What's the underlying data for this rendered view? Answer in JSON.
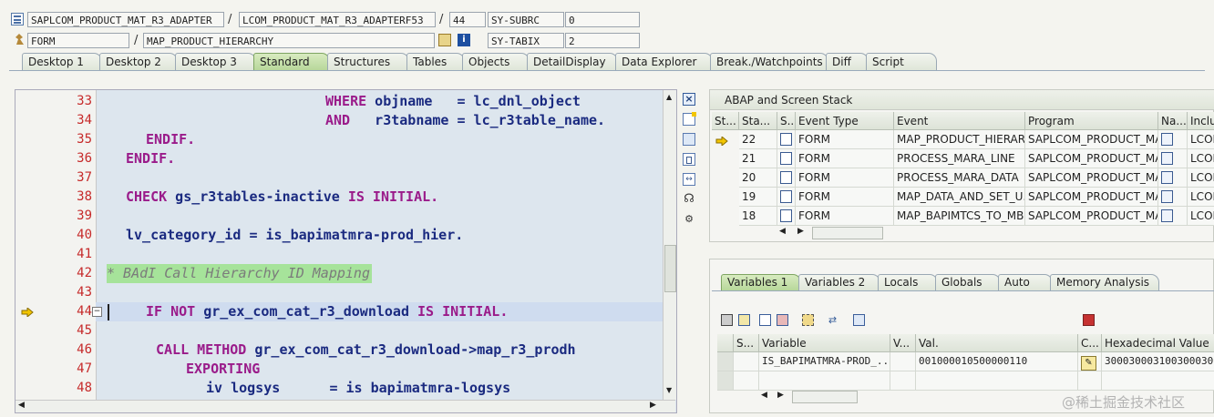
{
  "header": {
    "row1": {
      "program": "SAPLCOM_PRODUCT_MAT_R3_ADAPTER",
      "include": "LCOM_PRODUCT_MAT_R3_ADAPTERF53",
      "line": "44",
      "sysfield": "SY-SUBRC",
      "sysvalue": "0"
    },
    "row2": {
      "type": "FORM",
      "name": "MAP_PRODUCT_HIERARCHY",
      "sysfield": "SY-TABIX",
      "sysvalue": "2"
    },
    "sep": "/"
  },
  "tabs": [
    "Desktop 1",
    "Desktop 2",
    "Desktop 3",
    "Standard",
    "Structures",
    "Tables",
    "Objects",
    "DetailDisplay",
    "Data Explorer",
    "Break./Watchpoints",
    "Diff",
    "Script"
  ],
  "active_tab": "Standard",
  "code": {
    "lines": [
      "33",
      "34",
      "35",
      "36",
      "37",
      "38",
      "39",
      "40",
      "41",
      "42",
      "43",
      "44",
      "45",
      "46",
      "47",
      "48"
    ],
    "l33a": "WHERE",
    "l33b": " objname   = lc_dnl_object",
    "l34a": "AND  ",
    "l34b": " r3tabname = lc_r3table_name.",
    "l35": "ENDIF.",
    "l36": "ENDIF.",
    "l38a": "CHECK",
    "l38b": " gs_r3tables-inactive ",
    "l38c": "IS INITIAL.",
    "l40": "lv_category_id = is_bapimatmra-prod_hier.",
    "l42": "* BAdI Call Hierarchy ID Mapping",
    "l44a": "IF NOT",
    "l44b": " gr_ex_com_cat_r3_download ",
    "l44c": "IS INITIAL.",
    "l46a": "CALL METHOD",
    "l46b": " gr_ex_com_cat_r3_download->map_r3_prodh",
    "l47": "EXPORTING",
    "l48": "iv logsys      = is bapimatmra-logsys"
  },
  "stack": {
    "title": "ABAP and Screen Stack",
    "columns": [
      "St...",
      "Sta...",
      "S...",
      "Event Type",
      "Event",
      "Program",
      "Na...",
      "Inclu"
    ],
    "rows": [
      {
        "num": "22",
        "type": "FORM",
        "event": "MAP_PRODUCT_HIERAR...",
        "program": "SAPLCOM_PRODUCT_MA...",
        "incl": "LCOM"
      },
      {
        "num": "21",
        "type": "FORM",
        "event": "PROCESS_MARA_LINE",
        "program": "SAPLCOM_PRODUCT_MA...",
        "incl": "LCOM"
      },
      {
        "num": "20",
        "type": "FORM",
        "event": "PROCESS_MARA_DATA",
        "program": "SAPLCOM_PRODUCT_MA...",
        "incl": "LCOM"
      },
      {
        "num": "19",
        "type": "FORM",
        "event": "MAP_DATA_AND_SET_U...",
        "program": "SAPLCOM_PRODUCT_MA...",
        "incl": "LCOM"
      },
      {
        "num": "18",
        "type": "FORM",
        "event": "MAP_BAPIMTCS_TO_MB...",
        "program": "SAPLCOM_PRODUCT_MA...",
        "incl": "LCOM"
      }
    ]
  },
  "vartabs": [
    "Variables 1",
    "Variables 2",
    "Locals",
    "Globals",
    "Auto",
    "Memory Analysis"
  ],
  "active_vartab": "Variables 1",
  "vars": {
    "columns": [
      "S...",
      "Variable",
      "V...",
      "Val.",
      "C...",
      "Hexadecimal Value"
    ],
    "row": {
      "variable": "IS_BAPIMATMRA-PROD_...",
      "value": "001000010500000110",
      "hex": "3000300031003000300"
    }
  },
  "watermark": "@稀土掘金技术社区",
  "colors": {
    "accent_tab": "#b7d79a",
    "editor_bg": "#dde6ee",
    "keyword": "#9a1b8a",
    "lineno": "#c62a2a"
  }
}
